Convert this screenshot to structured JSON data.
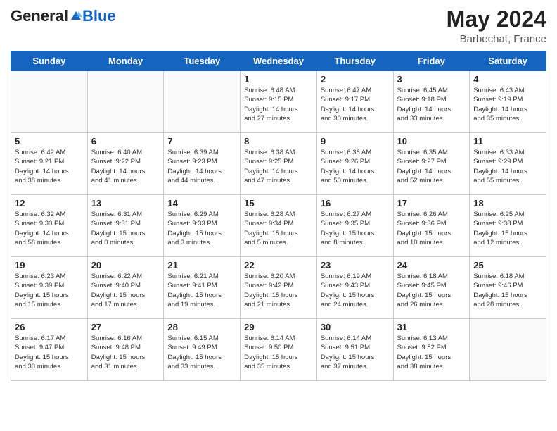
{
  "header": {
    "logo_general": "General",
    "logo_blue": "Blue",
    "month_year": "May 2024",
    "location": "Barbechat, France"
  },
  "weekdays": [
    "Sunday",
    "Monday",
    "Tuesday",
    "Wednesday",
    "Thursday",
    "Friday",
    "Saturday"
  ],
  "weeks": [
    [
      {
        "day": "",
        "info": ""
      },
      {
        "day": "",
        "info": ""
      },
      {
        "day": "",
        "info": ""
      },
      {
        "day": "1",
        "info": "Sunrise: 6:48 AM\nSunset: 9:15 PM\nDaylight: 14 hours\nand 27 minutes."
      },
      {
        "day": "2",
        "info": "Sunrise: 6:47 AM\nSunset: 9:17 PM\nDaylight: 14 hours\nand 30 minutes."
      },
      {
        "day": "3",
        "info": "Sunrise: 6:45 AM\nSunset: 9:18 PM\nDaylight: 14 hours\nand 33 minutes."
      },
      {
        "day": "4",
        "info": "Sunrise: 6:43 AM\nSunset: 9:19 PM\nDaylight: 14 hours\nand 35 minutes."
      }
    ],
    [
      {
        "day": "5",
        "info": "Sunrise: 6:42 AM\nSunset: 9:21 PM\nDaylight: 14 hours\nand 38 minutes."
      },
      {
        "day": "6",
        "info": "Sunrise: 6:40 AM\nSunset: 9:22 PM\nDaylight: 14 hours\nand 41 minutes."
      },
      {
        "day": "7",
        "info": "Sunrise: 6:39 AM\nSunset: 9:23 PM\nDaylight: 14 hours\nand 44 minutes."
      },
      {
        "day": "8",
        "info": "Sunrise: 6:38 AM\nSunset: 9:25 PM\nDaylight: 14 hours\nand 47 minutes."
      },
      {
        "day": "9",
        "info": "Sunrise: 6:36 AM\nSunset: 9:26 PM\nDaylight: 14 hours\nand 50 minutes."
      },
      {
        "day": "10",
        "info": "Sunrise: 6:35 AM\nSunset: 9:27 PM\nDaylight: 14 hours\nand 52 minutes."
      },
      {
        "day": "11",
        "info": "Sunrise: 6:33 AM\nSunset: 9:29 PM\nDaylight: 14 hours\nand 55 minutes."
      }
    ],
    [
      {
        "day": "12",
        "info": "Sunrise: 6:32 AM\nSunset: 9:30 PM\nDaylight: 14 hours\nand 58 minutes."
      },
      {
        "day": "13",
        "info": "Sunrise: 6:31 AM\nSunset: 9:31 PM\nDaylight: 15 hours\nand 0 minutes."
      },
      {
        "day": "14",
        "info": "Sunrise: 6:29 AM\nSunset: 9:33 PM\nDaylight: 15 hours\nand 3 minutes."
      },
      {
        "day": "15",
        "info": "Sunrise: 6:28 AM\nSunset: 9:34 PM\nDaylight: 15 hours\nand 5 minutes."
      },
      {
        "day": "16",
        "info": "Sunrise: 6:27 AM\nSunset: 9:35 PM\nDaylight: 15 hours\nand 8 minutes."
      },
      {
        "day": "17",
        "info": "Sunrise: 6:26 AM\nSunset: 9:36 PM\nDaylight: 15 hours\nand 10 minutes."
      },
      {
        "day": "18",
        "info": "Sunrise: 6:25 AM\nSunset: 9:38 PM\nDaylight: 15 hours\nand 12 minutes."
      }
    ],
    [
      {
        "day": "19",
        "info": "Sunrise: 6:23 AM\nSunset: 9:39 PM\nDaylight: 15 hours\nand 15 minutes."
      },
      {
        "day": "20",
        "info": "Sunrise: 6:22 AM\nSunset: 9:40 PM\nDaylight: 15 hours\nand 17 minutes."
      },
      {
        "day": "21",
        "info": "Sunrise: 6:21 AM\nSunset: 9:41 PM\nDaylight: 15 hours\nand 19 minutes."
      },
      {
        "day": "22",
        "info": "Sunrise: 6:20 AM\nSunset: 9:42 PM\nDaylight: 15 hours\nand 21 minutes."
      },
      {
        "day": "23",
        "info": "Sunrise: 6:19 AM\nSunset: 9:43 PM\nDaylight: 15 hours\nand 24 minutes."
      },
      {
        "day": "24",
        "info": "Sunrise: 6:18 AM\nSunset: 9:45 PM\nDaylight: 15 hours\nand 26 minutes."
      },
      {
        "day": "25",
        "info": "Sunrise: 6:18 AM\nSunset: 9:46 PM\nDaylight: 15 hours\nand 28 minutes."
      }
    ],
    [
      {
        "day": "26",
        "info": "Sunrise: 6:17 AM\nSunset: 9:47 PM\nDaylight: 15 hours\nand 30 minutes."
      },
      {
        "day": "27",
        "info": "Sunrise: 6:16 AM\nSunset: 9:48 PM\nDaylight: 15 hours\nand 31 minutes."
      },
      {
        "day": "28",
        "info": "Sunrise: 6:15 AM\nSunset: 9:49 PM\nDaylight: 15 hours\nand 33 minutes."
      },
      {
        "day": "29",
        "info": "Sunrise: 6:14 AM\nSunset: 9:50 PM\nDaylight: 15 hours\nand 35 minutes."
      },
      {
        "day": "30",
        "info": "Sunrise: 6:14 AM\nSunset: 9:51 PM\nDaylight: 15 hours\nand 37 minutes."
      },
      {
        "day": "31",
        "info": "Sunrise: 6:13 AM\nSunset: 9:52 PM\nDaylight: 15 hours\nand 38 minutes."
      },
      {
        "day": "",
        "info": ""
      }
    ]
  ]
}
